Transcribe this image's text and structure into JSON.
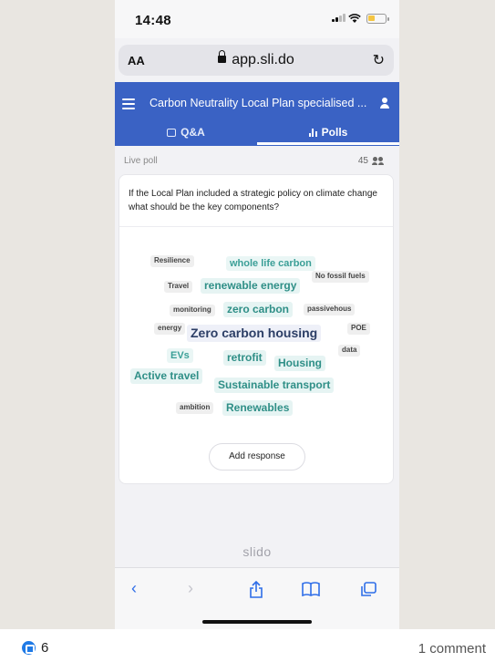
{
  "status": {
    "time": "14:48"
  },
  "browser": {
    "text_size_label": "AA",
    "url": "app.sli.do",
    "reload_icon": "reload-icon"
  },
  "app": {
    "title": "Carbon Neutrality Local Plan specialised ...",
    "tabs": [
      {
        "label": "Q&A"
      },
      {
        "label": "Polls"
      }
    ],
    "active_tab": "Polls",
    "accent_color": "#3a62c4"
  },
  "poll": {
    "status_label": "Live poll",
    "participant_count": "45",
    "question": "If the Local Plan included a strategic policy on climate change what should be the key components?",
    "words": [
      {
        "text": "Resilience",
        "style": "grey"
      },
      {
        "text": "whole life carbon",
        "style": "teal"
      },
      {
        "text": "No fossil fuels",
        "style": "grey"
      },
      {
        "text": "Travel",
        "style": "grey"
      },
      {
        "text": "renewable energy",
        "style": "teal-lg"
      },
      {
        "text": "monitoring",
        "style": "grey"
      },
      {
        "text": "zero carbon",
        "style": "teal-lg"
      },
      {
        "text": "passivehous",
        "style": "grey"
      },
      {
        "text": "energy",
        "style": "grey"
      },
      {
        "text": "Zero carbon housing",
        "style": "navy"
      },
      {
        "text": "POE",
        "style": "grey"
      },
      {
        "text": "EVs",
        "style": "teal"
      },
      {
        "text": "retrofit",
        "style": "teal-lg"
      },
      {
        "text": "data",
        "style": "grey"
      },
      {
        "text": "Housing",
        "style": "teal-lg"
      },
      {
        "text": "Active travel",
        "style": "teal-lg"
      },
      {
        "text": "Sustainable transport",
        "style": "teal-lg"
      },
      {
        "text": "ambition",
        "style": "grey"
      },
      {
        "text": "Renewables",
        "style": "teal-lg"
      }
    ],
    "add_response_label": "Add response"
  },
  "branding": {
    "footer_logo_text": "slido"
  },
  "post": {
    "reaction_count": "6",
    "comments_label": "1 comment"
  }
}
